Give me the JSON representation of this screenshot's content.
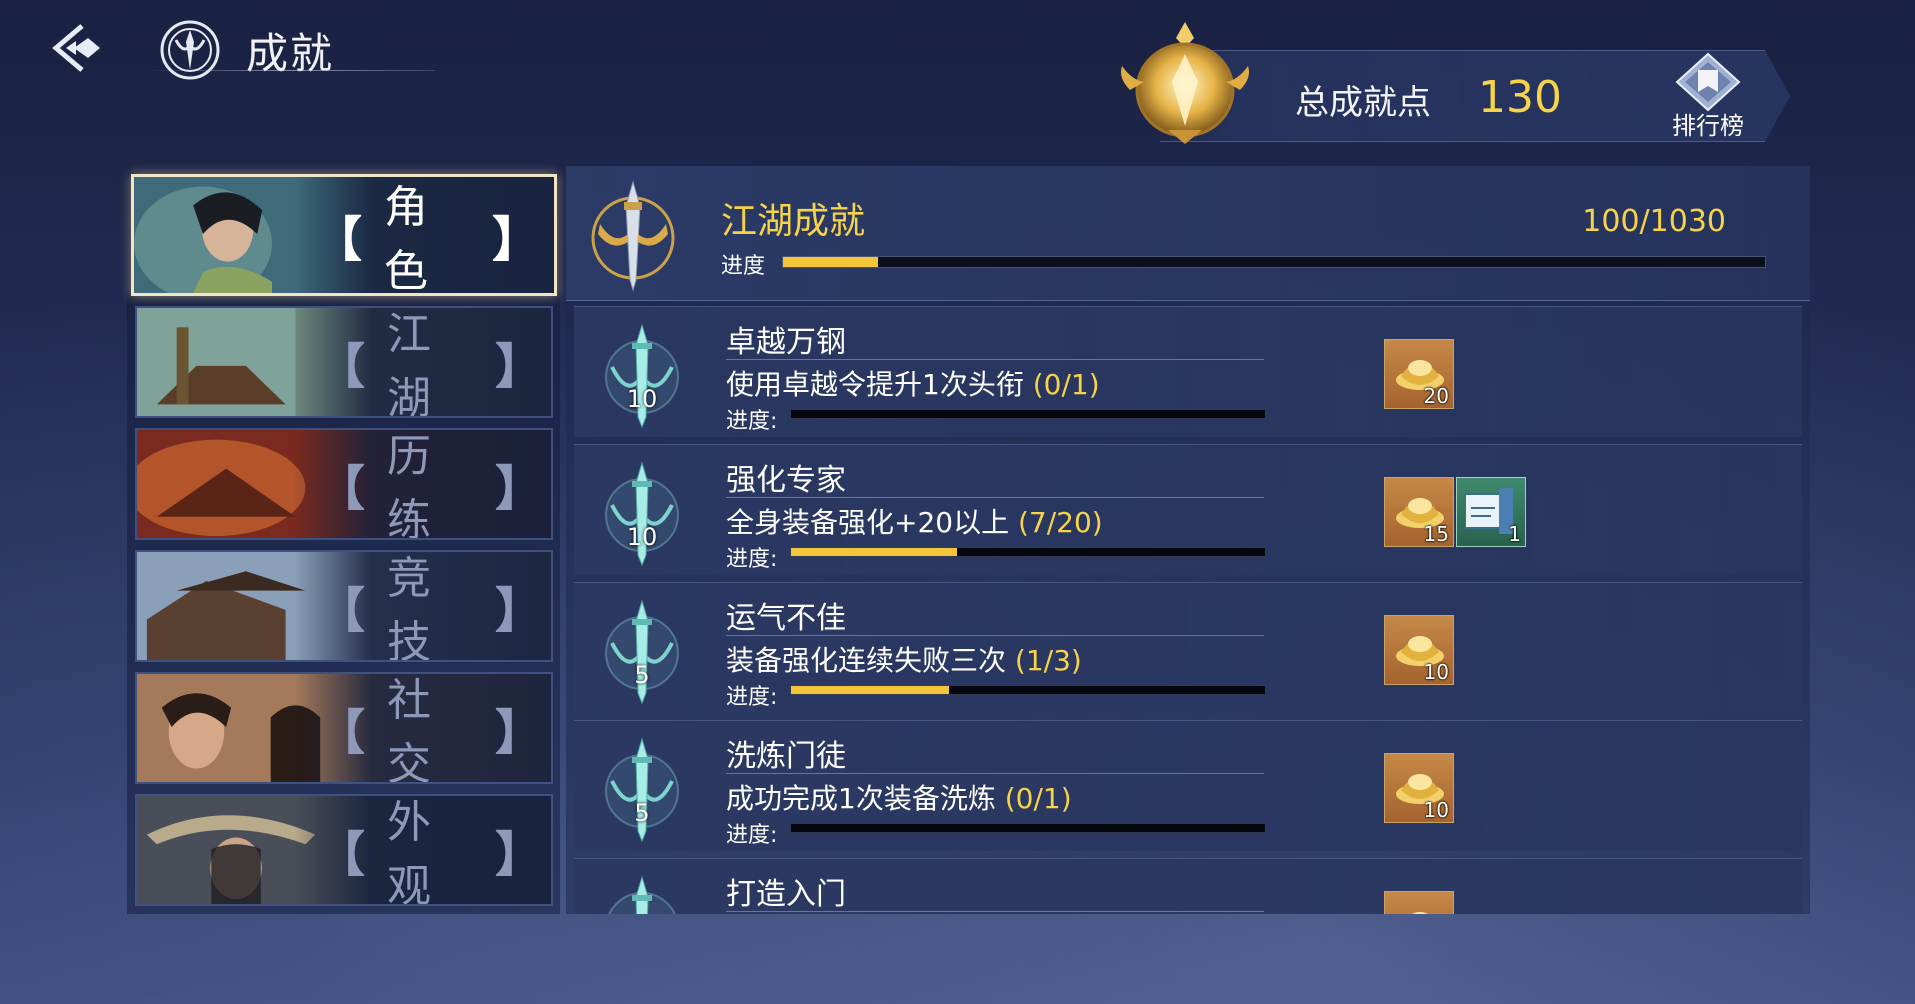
{
  "header": {
    "title": "成就",
    "back_icon": "back-arrow-icon",
    "emblem_icon": "achievement-emblem-icon"
  },
  "points": {
    "label": "总成就点",
    "value": "130",
    "rank_label": "排行榜",
    "rank_icon": "ranking-icon"
  },
  "nav": {
    "items": [
      {
        "label": "角色",
        "active": true
      },
      {
        "label": "江湖",
        "active": false
      },
      {
        "label": "历练",
        "active": false
      },
      {
        "label": "竞技",
        "active": false
      },
      {
        "label": "社交",
        "active": false
      },
      {
        "label": "外观",
        "active": false
      }
    ],
    "bracket_left": "【",
    "bracket_right": "】"
  },
  "summary": {
    "title": "江湖成就",
    "count": "100/1030",
    "progress_label": "进度",
    "progress": 0.097
  },
  "achievements": [
    {
      "title": "卓越万钢",
      "desc": "使用卓越令提升1次头衔",
      "count": "(0/1)",
      "progress_label": "进度:",
      "level": "10",
      "progress": 0.0,
      "rewards": [
        {
          "type": "gold-ingot-icon",
          "qty": "20"
        }
      ]
    },
    {
      "title": "强化专家",
      "desc": "全身装备强化+20以上",
      "count": "(7/20)",
      "progress_label": "进度:",
      "level": "10",
      "progress": 0.35,
      "rewards": [
        {
          "type": "gold-ingot-icon",
          "qty": "15"
        },
        {
          "type": "title-scroll-icon",
          "qty": "1"
        }
      ]
    },
    {
      "title": "运气不佳",
      "desc": "装备强化连续失败三次",
      "count": "(1/3)",
      "progress_label": "进度:",
      "level": "5",
      "progress": 0.333,
      "rewards": [
        {
          "type": "gold-ingot-icon",
          "qty": "10"
        }
      ]
    },
    {
      "title": "洗炼门徒",
      "desc": "成功完成1次装备洗炼",
      "count": "(0/1)",
      "progress_label": "进度:",
      "level": "5",
      "progress": 0.0,
      "rewards": [
        {
          "type": "gold-ingot-icon",
          "qty": "10"
        }
      ]
    },
    {
      "title": "打造入门",
      "desc": "",
      "count": "",
      "progress_label": "",
      "level": "",
      "progress": 0.0,
      "rewards": [
        {
          "type": "gold-ingot-icon",
          "qty": ""
        }
      ]
    }
  ],
  "colors": {
    "accent_gold": "#f7d34a",
    "progress_fill": "#f2c53a",
    "active_border": "#f1e6c4"
  }
}
